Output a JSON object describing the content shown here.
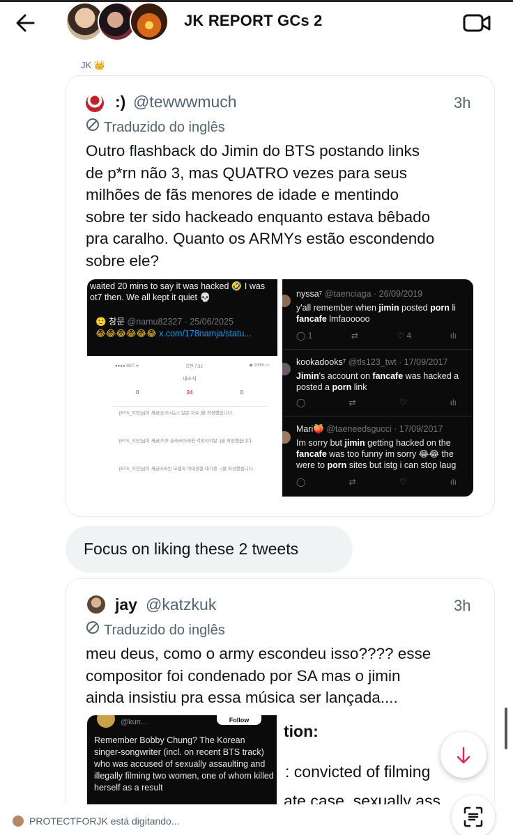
{
  "header": {
    "back_icon": "arrow-left-icon",
    "title": "JK REPORT GCs 2",
    "video_icon": "video-call-icon"
  },
  "message_sender": "JK 👑",
  "tweet1": {
    "name": ":)",
    "handle": "@tewwwmuch",
    "time": "3h",
    "translated": "Traduzido do inglês",
    "lines": [
      "Outro flashback do Jimin do BTS postando links",
      "de p*rn não 3, mas QUATRO vezes para seus",
      "milhões de fãs menores de idade e mentindo",
      "sobre ter sido hackeado enquanto estava bêbado",
      "pra caralho. Quanto os ARMYs estão escondendo",
      "sobre ele?"
    ],
    "media_left": {
      "caption": "waited 20 mins to say it was hacked 🤣 I was ot7 then. We all kept it quiet 💀",
      "quote_name": "🙂 창문",
      "quote_handle": "@namu82327 · 25/06/2025",
      "quote_emojis": "😂😂😂😂😂😂",
      "quote_link": "x.com/178namja/statu...",
      "phone_status_left": "●●●● SKT ᯤ",
      "phone_status_mid": "오전 7:32",
      "phone_status_right": "◉ 100% ▭",
      "phone_title": "내소식",
      "phone_tabs": [
        "0",
        "34",
        "0"
      ],
      "phone_rows": [
        "[BTS_지민]님이 새글[눈오시는!! 알콘 자요 ]을 작성했습니다.",
        "[BTS_지민]님이 새글[이후 놀래러어셔용 각성하지말..]을 작성했습니다.",
        "[BTS_지민]님이 새글[S라인 모델과 여대생들 대기중 ..]을 작성했습니다."
      ]
    },
    "media_right": [
      {
        "name": "nyssa⁷",
        "handle": "@taenciaga · 26/09/2019",
        "line1_pre": "y'all remember when ",
        "line1_bold": "jimin",
        "line1_mid": " posted ",
        "line1_bold2": "porn",
        "line1_post": " li",
        "line2_bold": "fancafe",
        "line2_post": " lmfaooooo",
        "replies": "1",
        "likes": "4"
      },
      {
        "name": "kookadooks⁷",
        "handle": "@tls123_twt · 17/09/2017",
        "line1_bold": "Jimin",
        "line1_post": "'s account on ",
        "line1_bold2": "fancafe",
        "line1_tail": " was hacked a",
        "line2_pre": "posted a ",
        "line2_bold": "porn",
        "line2_post": " link"
      },
      {
        "name": "Mari🍑",
        "handle": "@taeneedsgucci · 17/09/2017",
        "line1_pre": "Im sorry but ",
        "line1_bold": "jimin",
        "line1_post": " getting hacked on the",
        "line2_bold": "fancafe",
        "line2_post": " was too funny im sorry 😂😂 the",
        "line3_pre": "were to ",
        "line3_bold": "porn",
        "line3_post": " sites but istg i can stop laug"
      }
    ]
  },
  "message": "Focus on liking these 2 tweets",
  "tweet2": {
    "name": "jay",
    "handle": "@katzkuk",
    "time": "3h",
    "translated": "Traduzido do inglês",
    "lines": [
      "meu deus, como o army escondeu isso???? esse",
      "compositor foi condenado por SA mas o jimin",
      "ainda insistiu pra essa música ser lançada...."
    ],
    "media_left": {
      "handle": "@kun...",
      "follow": "Follow",
      "text": "Remember Bobby Chung? The Korean singer-songwriter (incl. on recent BTS track) who was accused of sexually assaulting and illegally filming two women, one of whom killed herself as a result"
    },
    "media_right": {
      "line1": "tion:",
      "line2": ": convicted of filming",
      "line3": "ate case, sexually ass"
    }
  },
  "typing_indicator": "PROTECTFORJK está digitando...",
  "scroll_down_icon": "arrow-down-icon",
  "lens_icon": "text-scan-icon",
  "colors": {
    "accent": "#e0245e",
    "link": "#1d9bf0",
    "muted": "#536471"
  }
}
